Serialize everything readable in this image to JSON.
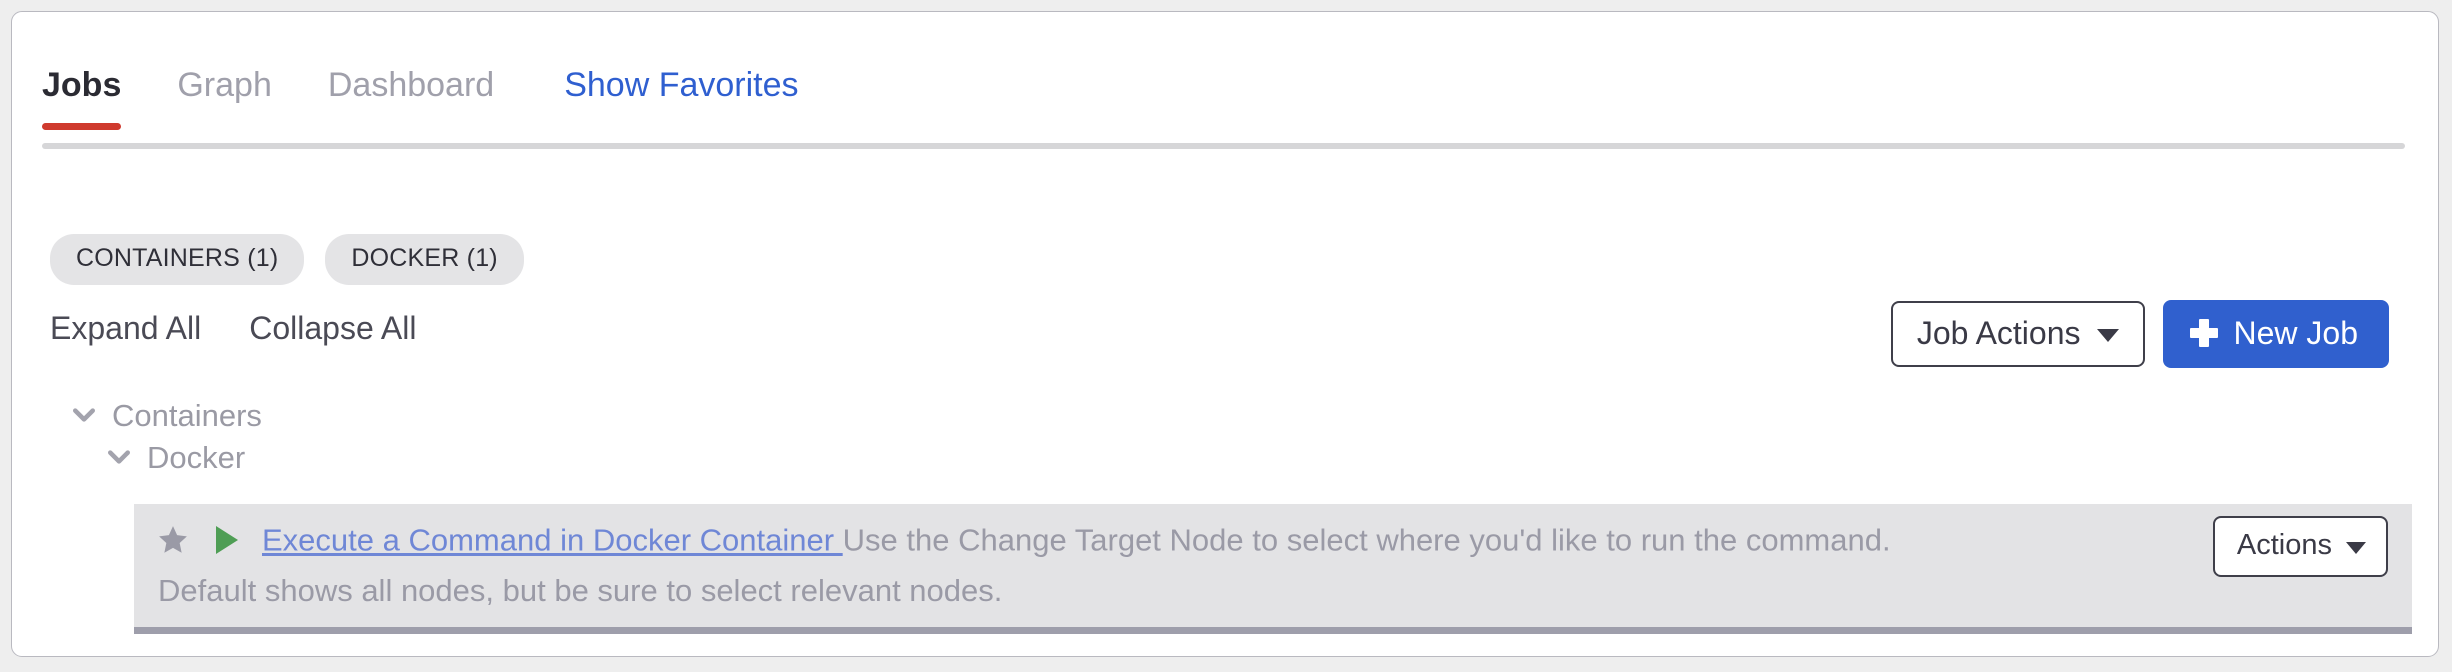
{
  "tabs": [
    {
      "label": "Jobs",
      "active": true
    },
    {
      "label": "Graph",
      "active": false
    },
    {
      "label": "Dashboard",
      "active": false
    }
  ],
  "favorites_link": "Show Favorites",
  "chips": [
    {
      "label": "CONTAINERS (1)"
    },
    {
      "label": "DOCKER (1)"
    }
  ],
  "toolbar": {
    "expand_all": "Expand All",
    "collapse_all": "Collapse All",
    "job_actions": "Job Actions",
    "new_job": "New Job"
  },
  "tree": {
    "group_level1": "Containers",
    "group_level2": "Docker"
  },
  "job": {
    "link": "Execute a Command in Docker Container ",
    "description_line1": "Use the Change Target Node to select where you'd like to run the command.",
    "description_line2": "Default shows all nodes, but be sure to select relevant nodes.",
    "actions_label": "Actions"
  },
  "colors": {
    "active_tab_underline": "#cf3a2e",
    "link_blue": "#2f5fd0",
    "primary_button": "#3060ce",
    "job_link": "#6f87d6",
    "play_green": "#4f9e55",
    "star_grey": "#9a9aa6",
    "row_background": "#e3e3e5",
    "chip_background": "#e4e4e6"
  }
}
